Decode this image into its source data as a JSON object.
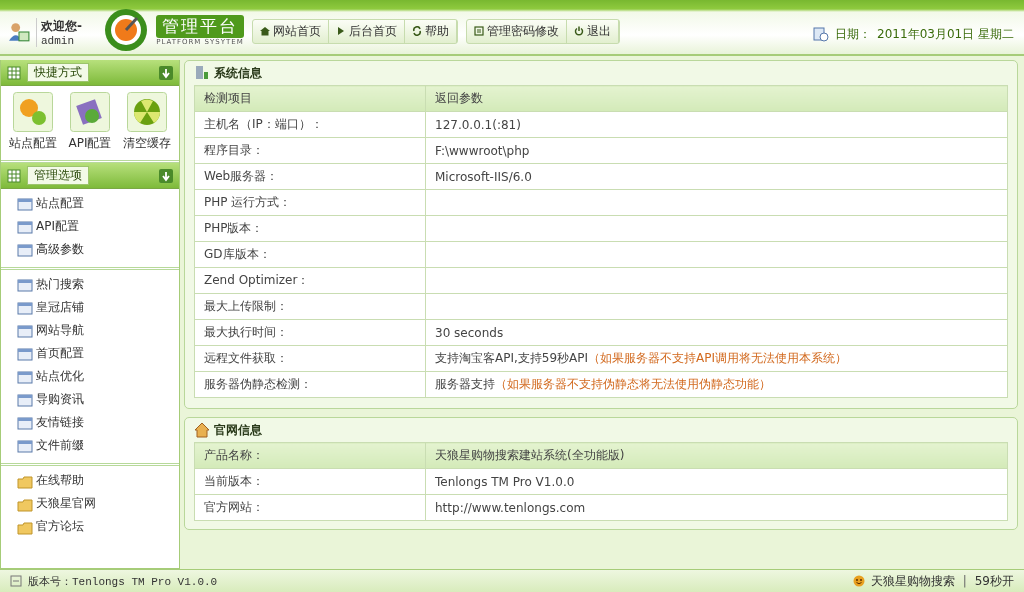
{
  "header": {
    "welcome": "欢迎您-",
    "user": "admin",
    "logo_title": "管理平台",
    "logo_subtitle": "PLATFORM SYSYTEM",
    "nav": [
      "网站首页",
      "后台首页",
      "帮助"
    ],
    "nav2": [
      "管理密码修改",
      "退出"
    ],
    "date_label": "日期：",
    "date": "2011年03月01日 星期二"
  },
  "sidebar": {
    "shortcuts": {
      "title": "快捷方式",
      "items": [
        "站点配置",
        "API配置",
        "清空缓存"
      ]
    },
    "menu": {
      "title": "管理选项",
      "groups": [
        [
          "站点配置",
          "API配置",
          "高级参数"
        ],
        [
          "热门搜索",
          "皇冠店铺",
          "网站导航",
          "首页配置",
          "站点优化",
          "导购资讯",
          "友情链接",
          "文件前缀"
        ],
        [
          "在线帮助",
          "天狼星官网",
          "官方论坛"
        ]
      ]
    }
  },
  "sections": [
    {
      "title": "系统信息",
      "columns": [
        "检测项目",
        "返回参数"
      ],
      "rows": [
        {
          "label": "主机名（IP：端口）：",
          "value": "127.0.0.1(:81)"
        },
        {
          "label": "程序目录：",
          "value": "F:\\wwwroot\\php"
        },
        {
          "label": "Web服务器：",
          "value": "Microsoft-IIS/6.0"
        },
        {
          "label": "PHP 运行方式："
        },
        {
          "label": "PHP版本："
        },
        {
          "label": "GD库版本："
        },
        {
          "label": "Zend Optimizer："
        },
        {
          "label": "最大上传限制："
        },
        {
          "label": "最大执行时间：",
          "value": "30 seconds"
        },
        {
          "label": "远程文件获取：",
          "value": "支持淘宝客API,支持59秒API",
          "note": "（如果服务器不支持API调用将无法使用本系统）"
        },
        {
          "label": "服务器伪静态检测：",
          "value": "服务器支持",
          "note": "（如果服务器不支持伪静态将无法使用伪静态功能）"
        }
      ]
    },
    {
      "title": "官网信息",
      "rows": [
        {
          "label": "产品名称：",
          "value": "天狼星购物搜索建站系统(全功能版)"
        },
        {
          "label": "当前版本：",
          "value": "Tenlongs TM Pro V1.0.0"
        },
        {
          "label": "官方网站：",
          "value": "http://www.tenlongs.com"
        }
      ]
    }
  ],
  "status_bar": {
    "version": "版本号：Tenlongs TM Pro V1.0.0",
    "brand": "天狼星购物搜索",
    "separator": "|",
    "extra": "59秒开"
  }
}
